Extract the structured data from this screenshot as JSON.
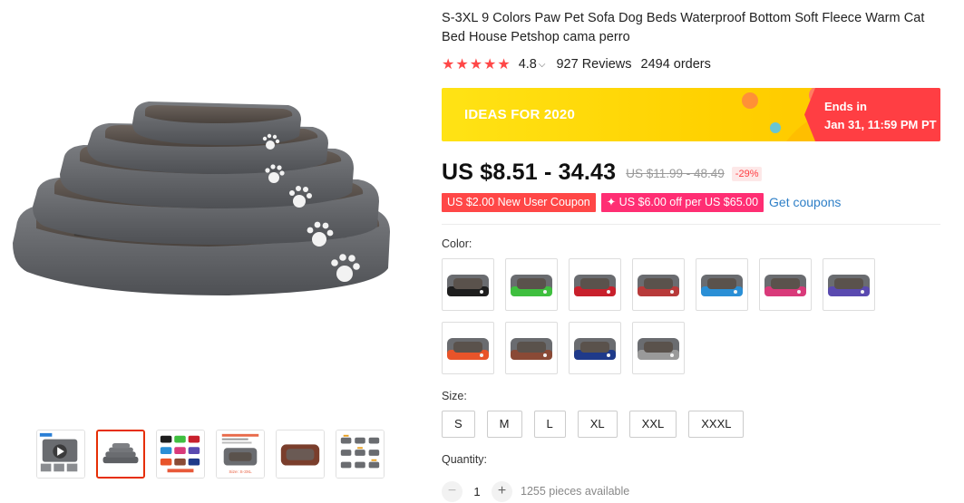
{
  "gallery": {
    "thumbnails": [
      {
        "name": "video"
      },
      {
        "name": "stacked-beds"
      },
      {
        "name": "color-grid"
      },
      {
        "name": "size-chart"
      },
      {
        "name": "brown-bed"
      },
      {
        "name": "size-guide"
      }
    ],
    "active_index": 1,
    "thumb_texts": {
      "size_chart_caption": "Size: S-3XL"
    }
  },
  "product": {
    "title": "S-3XL 9 Colors Paw Pet Sofa Dog Beds Waterproof Bottom Soft Fleece Warm Cat Bed House Petshop cama perro",
    "rating": "4.8",
    "reviews": "927 Reviews",
    "orders": "2494 orders",
    "star_count": 5,
    "star_color": "#ff4747"
  },
  "promo": {
    "title": "IDEAS FOR 2020",
    "ends_label": "Ends in",
    "ends_date": "Jan 31, 11:59 PM PT",
    "bg_color": "#ffd100",
    "ends_color": "#ff3e43"
  },
  "price": {
    "current": "US $8.51 - 34.43",
    "original": "US $11.99 - 48.49",
    "discount": "-29%"
  },
  "coupons": {
    "new_user": "US $2.00 New User Coupon",
    "store": "✦ US $6.00 off per US $65.00",
    "get_link": "Get coupons"
  },
  "color": {
    "label": "Color:",
    "options": [
      {
        "name": "black",
        "hex": "#1e1e1e"
      },
      {
        "name": "green",
        "hex": "#3fbf3f"
      },
      {
        "name": "red",
        "hex": "#c8202c"
      },
      {
        "name": "gray-red",
        "hex": "#b83a3a"
      },
      {
        "name": "blue",
        "hex": "#2a8fd6"
      },
      {
        "name": "pink",
        "hex": "#d93a7a"
      },
      {
        "name": "purple",
        "hex": "#5a4ab0"
      },
      {
        "name": "orange",
        "hex": "#e8542a"
      },
      {
        "name": "brown",
        "hex": "#8a4a36"
      },
      {
        "name": "navy",
        "hex": "#1f3a8a"
      },
      {
        "name": "light-gray",
        "hex": "#9a9a9a"
      }
    ]
  },
  "size": {
    "label": "Size:",
    "options": [
      "S",
      "M",
      "L",
      "XL",
      "XXL",
      "XXXL"
    ]
  },
  "quantity": {
    "label": "Quantity:",
    "minus": "−",
    "plus": "+",
    "value": "1",
    "available": "1255 pieces available"
  }
}
